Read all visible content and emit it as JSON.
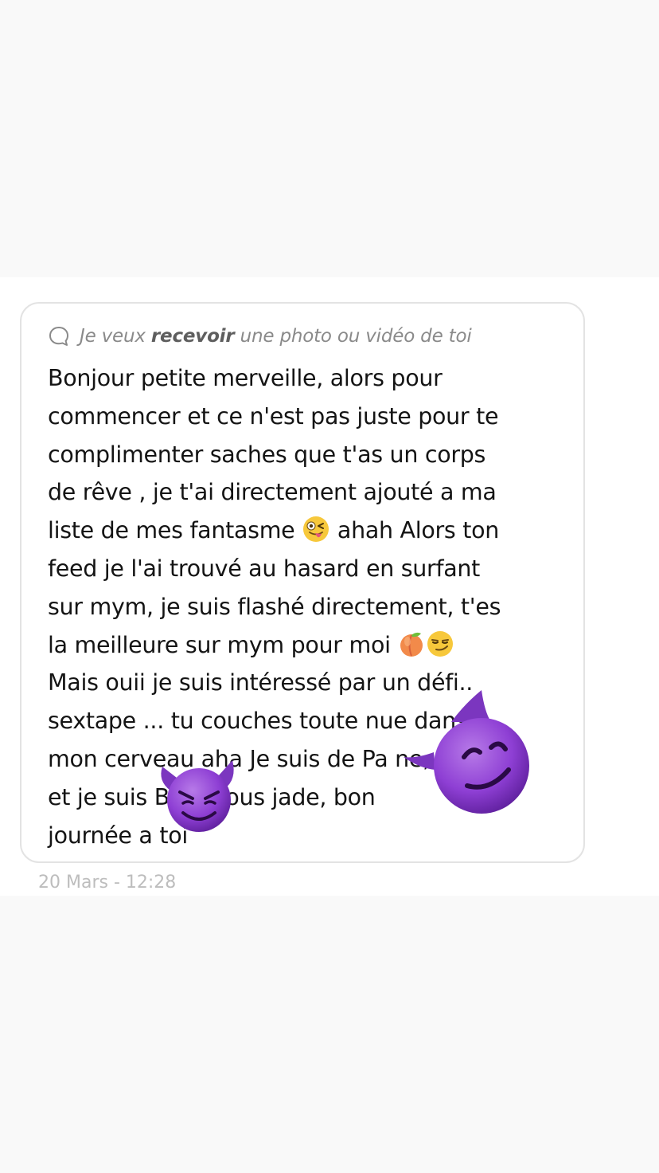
{
  "request": {
    "prefix": "Je veux ",
    "emphasis": "recevoir",
    "suffix": " une photo ou vidéo de toi",
    "icon": "chat-bubble-icon"
  },
  "message": {
    "lines": [
      {
        "text": "Bonjour petite merveille, alors pour"
      },
      {
        "text": "commencer et ce n'est pas juste pour te"
      },
      {
        "text": "complimenter saches que t'as un corps"
      },
      {
        "text": "de rêve , je t'ai directement ajouté a ma"
      },
      {
        "text": "liste de mes fantasme ",
        "after": " ahah Alors ton"
      },
      {
        "text": "feed je l'ai trouvé au hasard en surfant"
      },
      {
        "text": "sur mym, je suis flashé directement, t'es"
      },
      {
        "text": "la meilleure sur mym pour moi "
      },
      {
        "text": "Mais ouii je suis intéressé par un défi.."
      },
      {
        "text": "sextape ... tu couches toute nue dans"
      },
      {
        "text": "mon cerveau aha Je suis de Pa         ne,"
      },
      {
        "text": "et je suis B       r Bisous jade, bon"
      },
      {
        "text": "journée a toi"
      }
    ],
    "inline_emojis": [
      "winking-tongue-emoji",
      "peach-emoji",
      "smirk-emoji"
    ]
  },
  "timestamp": "20 Mars - 12:28",
  "stickers": [
    "smiling-devil-sticker",
    "smiling-devil-sticker"
  ],
  "colors": {
    "background": "#f9f9f9",
    "card_border": "#e3e3e3",
    "text": "#141414",
    "muted": "#8a8a8a",
    "timestamp": "#bdbdbd",
    "devil_purple": "#8e3fd4"
  }
}
